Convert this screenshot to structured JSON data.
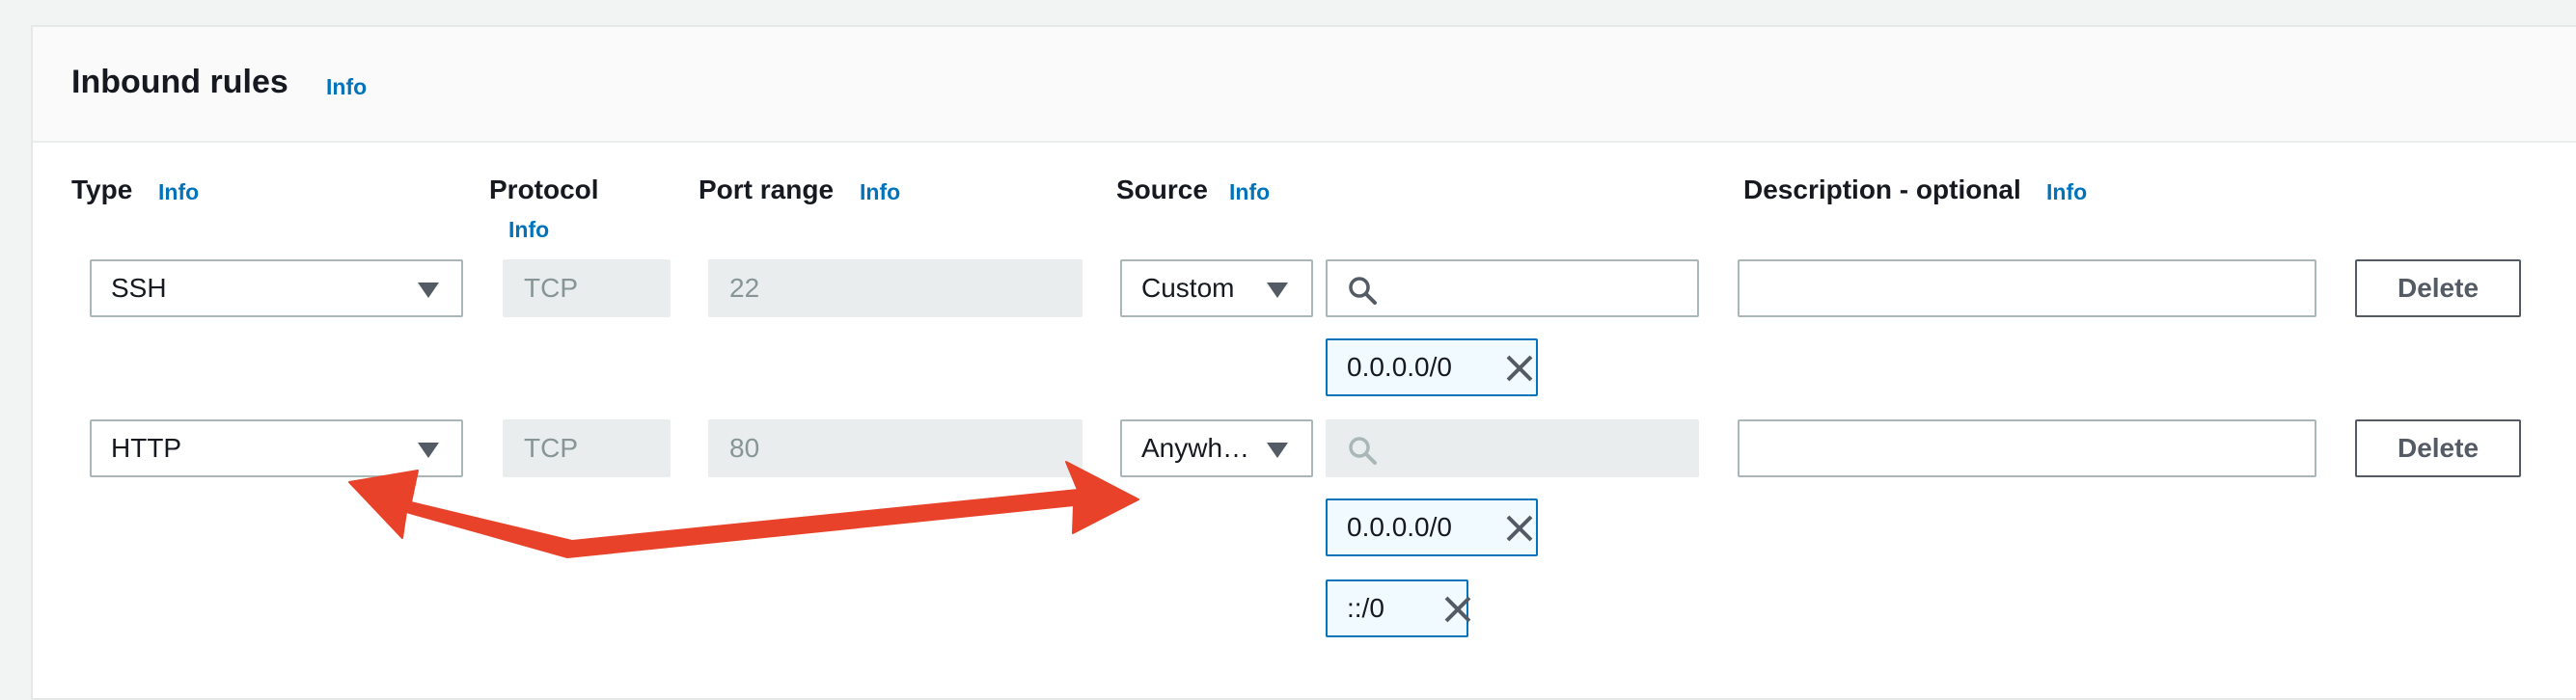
{
  "section": {
    "title": "Inbound rules",
    "info": "Info"
  },
  "columns": {
    "type": {
      "label": "Type",
      "info": "Info"
    },
    "protocol": {
      "label": "Protocol",
      "info": "Info"
    },
    "port_range": {
      "label": "Port range",
      "info": "Info"
    },
    "source": {
      "label": "Source",
      "info": "Info"
    },
    "description": {
      "label": "Description - optional",
      "info": "Info"
    }
  },
  "rules": [
    {
      "type": "SSH",
      "protocol": "TCP",
      "port_range": "22",
      "source_mode": "Custom",
      "source_search_enabled": true,
      "source_tokens": [
        "0.0.0.0/0"
      ],
      "description": "",
      "delete_label": "Delete"
    },
    {
      "type": "HTTP",
      "protocol": "TCP",
      "port_range": "80",
      "source_mode": "Anywh…",
      "source_search_enabled": false,
      "source_tokens": [
        "0.0.0.0/0",
        "::/0"
      ],
      "description": "",
      "delete_label": "Delete"
    }
  ],
  "colors": {
    "link": "#0073bb",
    "token_border": "#0073bb",
    "token_bg": "#f1faff",
    "disabled_bg": "#eaeded",
    "annotation_arrow": "#e8432a"
  },
  "icons": {
    "search": "search-icon",
    "caret": "caret-down-icon",
    "remove": "close-icon"
  }
}
